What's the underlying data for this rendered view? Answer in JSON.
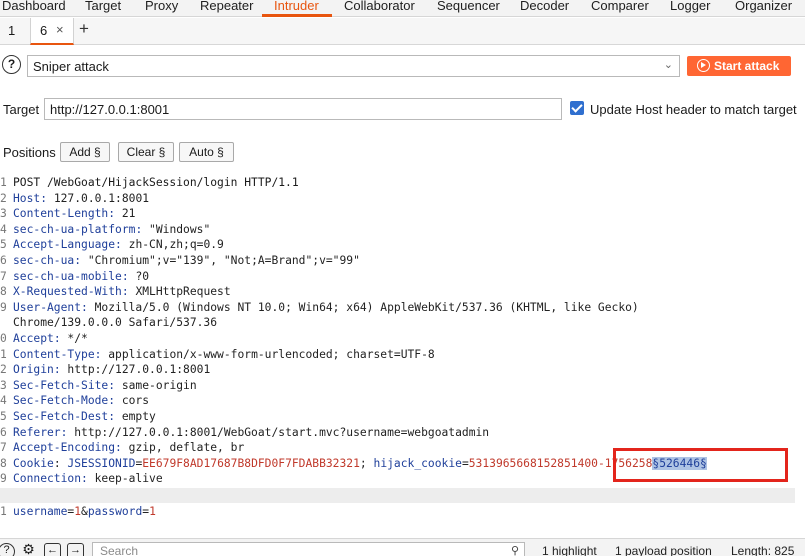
{
  "menu": {
    "items": [
      "Dashboard",
      "Target",
      "Proxy",
      "Repeater",
      "Intruder",
      "Collaborator",
      "Sequencer",
      "Decoder",
      "Comparer",
      "Logger",
      "Organizer"
    ],
    "active": "Intruder"
  },
  "subtabs": {
    "tab1": "1",
    "tab6": "6",
    "close_glyph": "×",
    "add_glyph": "+"
  },
  "attack": {
    "help_glyph": "?",
    "type": "Sniper attack",
    "start_label": "Start attack"
  },
  "target": {
    "label": "Target",
    "url": "http://127.0.0.1:8001",
    "update_host_checked": true,
    "update_host_label": "Update Host header to match target"
  },
  "positions": {
    "label": "Positions",
    "add_label": "Add §",
    "clear_label": "Clear §",
    "auto_label": "Auto §"
  },
  "request": {
    "request_line": "POST /WebGoat/HijackSession/login HTTP/1.1",
    "headers": [
      {
        "num": "2",
        "name": "Host",
        "value": " 127.0.0.1:8001"
      },
      {
        "num": "3",
        "name": "Content-Length",
        "value": " 21"
      },
      {
        "num": "4",
        "name": "sec-ch-ua-platform",
        "value": " \"Windows\""
      },
      {
        "num": "5",
        "name": "Accept-Language",
        "value": " zh-CN,zh;q=0.9"
      },
      {
        "num": "6",
        "name": "sec-ch-ua",
        "value": " \"Chromium\";v=\"139\", \"Not;A=Brand\";v=\"99\""
      },
      {
        "num": "7",
        "name": "sec-ch-ua-mobile",
        "value": " ?0"
      },
      {
        "num": "8",
        "name": "X-Requested-With",
        "value": " XMLHttpRequest"
      },
      {
        "num": "9",
        "name": "User-Agent",
        "value": " Mozilla/5.0 (Windows NT 10.0; Win64; x64) AppleWebKit/537.36 (KHTML, like Gecko)"
      }
    ],
    "ua_continuation": "Chrome/139.0.0.0 Safari/537.36",
    "headers2": [
      {
        "num": "0",
        "name": "Accept",
        "value": " */*"
      },
      {
        "num": "1",
        "name": "Content-Type",
        "value": " application/x-www-form-urlencoded; charset=UTF-8"
      },
      {
        "num": "2",
        "name": "Origin",
        "value": " http://127.0.0.1:8001"
      },
      {
        "num": "3",
        "name": "Sec-Fetch-Site",
        "value": " same-origin"
      },
      {
        "num": "4",
        "name": "Sec-Fetch-Mode",
        "value": " cors"
      },
      {
        "num": "5",
        "name": "Sec-Fetch-Dest",
        "value": " empty"
      },
      {
        "num": "6",
        "name": "Referer",
        "value": " http://127.0.0.1:8001/WebGoat/start.mvc?username=webgoatadmin"
      },
      {
        "num": "7",
        "name": "Accept-Encoding",
        "value": " gzip, deflate, br"
      }
    ],
    "cookie": {
      "num": "8",
      "name": "Cookie",
      "sep": ": ",
      "jsession_name": "JSESSIONID",
      "jsession_value": "EE679F8AD17687B8DFD0F7FDABB32321",
      "semicolon": "; ",
      "hijack_name": "hijack_cookie",
      "hijack_value": "5313965668152851400-1756258",
      "payload_marker": "§526446§"
    },
    "connection": {
      "num": "9",
      "name": "Connection",
      "value": " keep-alive"
    },
    "body": {
      "num": "1",
      "k1": "username",
      "v1": "1",
      "amp": "&",
      "k2": "password",
      "v2": "1"
    }
  },
  "bottom": {
    "search_placeholder": "Search",
    "highlights": "1 highlight",
    "payload_positions": "1 payload position",
    "length": "Length: 825"
  },
  "icons": {
    "help": "help-circle-icon",
    "gear": "gear-icon",
    "back": "arrow-left-icon",
    "forward": "arrow-right-icon",
    "search": "search-icon",
    "play": "play-circle-icon"
  },
  "colors": {
    "accent": "#e8550f",
    "start_button": "#ff6633",
    "header_name": "#1f3f9a",
    "cookie_value": "#c0392b",
    "payload_highlight": "#aec3e4",
    "annotation_box": "#e3251c"
  }
}
